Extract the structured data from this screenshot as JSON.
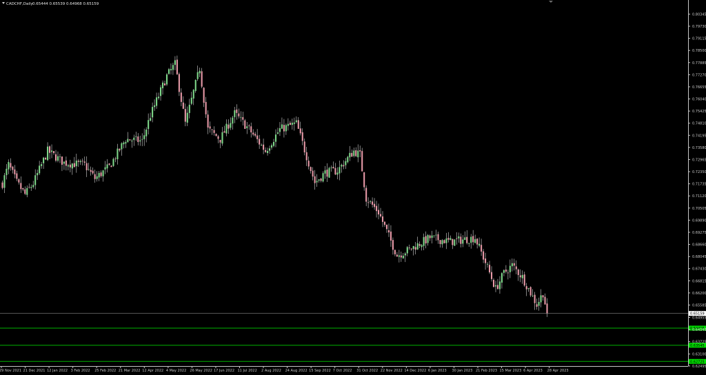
{
  "header": {
    "symbol": "CADCHF,Daily",
    "ohlc": "0.65444 0.65539 0.64968 0.65159"
  },
  "colors": {
    "background": "#000000",
    "axis": "#c8c8c8",
    "bull_body": "#7fd88a",
    "bear_body": "#e89aa8",
    "wick": "#d9d9d9",
    "level_line": "#00b400",
    "level_badge": "#00dd00"
  },
  "chart_data": {
    "type": "candlestick",
    "title": "",
    "ylim": [
      0.6249,
      0.8071
    ],
    "y_ticks": [
      "0.80345",
      "0.79730",
      "0.79115",
      "0.78500",
      "0.77885",
      "0.77270",
      "0.76655",
      "0.76040",
      "0.75425",
      "0.74810",
      "0.74195",
      "0.73580",
      "0.72965",
      "0.72350",
      "0.71735",
      "0.71120",
      "0.70505",
      "0.69890",
      "0.69275",
      "0.68660",
      "0.68045",
      "0.67430",
      "0.66815",
      "0.66200",
      "0.65585",
      "0.64955",
      "0.64345",
      "0.63725",
      "0.63100",
      "0.62495"
    ],
    "x_ticks": [
      "29 Nov 2021",
      "21 Dec 2021",
      "12 Jan 2022",
      "3 Feb 2022",
      "25 Feb 2022",
      "21 Mar 2022",
      "12 Apr 2022",
      "4 May 2022",
      "26 May 2022",
      "17 Jun 2022",
      "11 Jul 2022",
      "2 Aug 2022",
      "24 Aug 2022",
      "15 Sep 2022",
      "7 Oct 2022",
      "31 Oct 2022",
      "22 Nov 2022",
      "14 Dec 2022",
      "6 Jan 2023",
      "30 Jan 2023",
      "21 Feb 2023",
      "15 Mar 2023",
      "6 Apr 2023",
      "28 Apr 2023"
    ],
    "close_keypoints": [
      {
        "bar": 0,
        "v": 0.7175
      },
      {
        "bar": 3,
        "v": 0.727
      },
      {
        "bar": 7,
        "v": 0.718
      },
      {
        "bar": 11,
        "v": 0.712
      },
      {
        "bar": 15,
        "v": 0.7175
      },
      {
        "bar": 22,
        "v": 0.734
      },
      {
        "bar": 30,
        "v": 0.728
      },
      {
        "bar": 40,
        "v": 0.727
      },
      {
        "bar": 45,
        "v": 0.72
      },
      {
        "bar": 52,
        "v": 0.726
      },
      {
        "bar": 60,
        "v": 0.74
      },
      {
        "bar": 68,
        "v": 0.739
      },
      {
        "bar": 72,
        "v": 0.752
      },
      {
        "bar": 80,
        "v": 0.772
      },
      {
        "bar": 84,
        "v": 0.778
      },
      {
        "bar": 89,
        "v": 0.748
      },
      {
        "bar": 96,
        "v": 0.776
      },
      {
        "bar": 100,
        "v": 0.745
      },
      {
        "bar": 106,
        "v": 0.74
      },
      {
        "bar": 113,
        "v": 0.753
      },
      {
        "bar": 120,
        "v": 0.745
      },
      {
        "bar": 128,
        "v": 0.734
      },
      {
        "bar": 135,
        "v": 0.745
      },
      {
        "bar": 143,
        "v": 0.748
      },
      {
        "bar": 152,
        "v": 0.718
      },
      {
        "bar": 157,
        "v": 0.723
      },
      {
        "bar": 163,
        "v": 0.724
      },
      {
        "bar": 171,
        "v": 0.734
      },
      {
        "bar": 174,
        "v": 0.732
      },
      {
        "bar": 177,
        "v": 0.71
      },
      {
        "bar": 183,
        "v": 0.703
      },
      {
        "bar": 192,
        "v": 0.681
      },
      {
        "bar": 198,
        "v": 0.684
      },
      {
        "bar": 208,
        "v": 0.69
      },
      {
        "bar": 218,
        "v": 0.688
      },
      {
        "bar": 230,
        "v": 0.69
      },
      {
        "bar": 236,
        "v": 0.675
      },
      {
        "bar": 240,
        "v": 0.664
      },
      {
        "bar": 244,
        "v": 0.672
      },
      {
        "bar": 248,
        "v": 0.676
      },
      {
        "bar": 253,
        "v": 0.67
      },
      {
        "bar": 260,
        "v": 0.656
      },
      {
        "bar": 263,
        "v": 0.662
      },
      {
        "bar": 265,
        "v": 0.6516
      }
    ],
    "current_price": "0.65159",
    "levels": [
      {
        "price": "0.64415",
        "label": "0.64415"
      },
      {
        "price": "0.63545",
        "label": "0.63545"
      },
      {
        "price": "0.62725",
        "label": "0.62725"
      }
    ]
  }
}
